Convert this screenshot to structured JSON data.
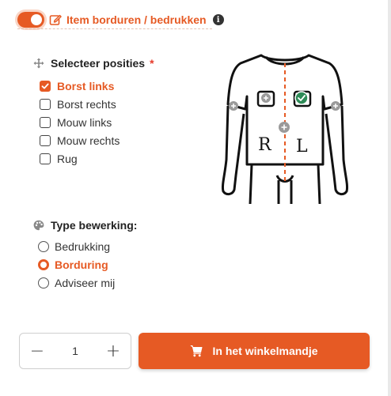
{
  "header": {
    "title": "Item borduren / bedrukken",
    "toggle_on": true,
    "info_glyph": "i"
  },
  "positions": {
    "title": "Selecteer posities",
    "required_mark": "*",
    "options": [
      {
        "label": "Borst links",
        "checked": true
      },
      {
        "label": "Borst rechts",
        "checked": false
      },
      {
        "label": "Mouw links",
        "checked": false
      },
      {
        "label": "Mouw rechts",
        "checked": false
      },
      {
        "label": "Rug",
        "checked": false
      }
    ]
  },
  "diagram": {
    "left_letter": "R",
    "right_letter": "L"
  },
  "treatment": {
    "title": "Type bewerking:",
    "options": [
      {
        "label": "Bedrukking",
        "checked": false
      },
      {
        "label": "Borduring",
        "checked": true
      },
      {
        "label": "Adviseer mij",
        "checked": false
      }
    ]
  },
  "quantity": {
    "minus": "−",
    "value": "1",
    "plus": "+"
  },
  "cart": {
    "label": "In het winkelmandje"
  },
  "colors": {
    "accent": "#e65a24",
    "check_green": "#2e8b57"
  }
}
